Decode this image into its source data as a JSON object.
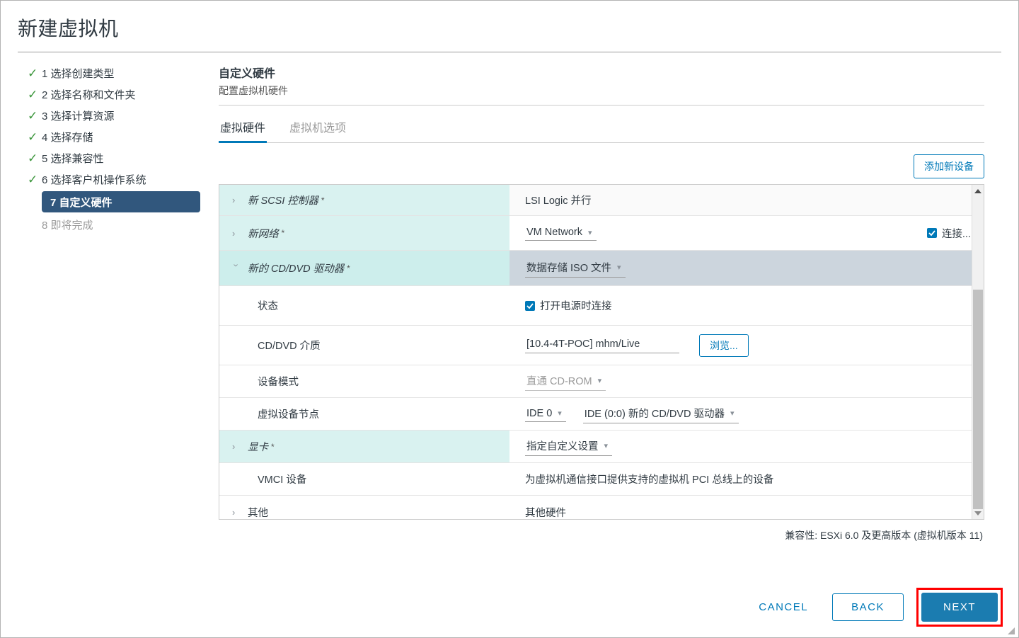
{
  "window": {
    "title": "新建虚拟机"
  },
  "steps": [
    {
      "num": "1",
      "label": "选择创建类型",
      "state": "done"
    },
    {
      "num": "2",
      "label": "选择名称和文件夹",
      "state": "done"
    },
    {
      "num": "3",
      "label": "选择计算资源",
      "state": "done"
    },
    {
      "num": "4",
      "label": "选择存储",
      "state": "done"
    },
    {
      "num": "5",
      "label": "选择兼容性",
      "state": "done"
    },
    {
      "num": "6",
      "label": "选择客户机操作系统",
      "state": "done"
    },
    {
      "num": "7",
      "label": "自定义硬件",
      "state": "active"
    },
    {
      "num": "8",
      "label": "即将完成",
      "state": "pending"
    }
  ],
  "step_labels": {
    "s1": "1 选择创建类型",
    "s2": "2 选择名称和文件夹",
    "s3": "3 选择计算资源",
    "s4": "4 选择存储",
    "s5": "5 选择兼容性",
    "s6": "6 选择客户机操作系统",
    "s7": "7 自定义硬件",
    "s8": "8 即将完成"
  },
  "section": {
    "title": "自定义硬件",
    "subtitle": "配置虚拟机硬件"
  },
  "tabs": {
    "hardware": "虚拟硬件",
    "vm_options": "虚拟机选项"
  },
  "toolbar": {
    "add_device_label": "添加新设备"
  },
  "hardware_rows": {
    "scsi": {
      "label": "新 SCSI 控制器",
      "star": "*",
      "value": "LSI Logic 并行"
    },
    "network": {
      "label": "新网络",
      "star": "*",
      "value": "VM Network",
      "connect_label": "连接...",
      "connect_checked": true
    },
    "cddvd": {
      "label": "新的 CD/DVD 驱动器",
      "star": "*",
      "value": "数据存储 ISO 文件"
    },
    "status": {
      "label": "状态",
      "checkbox_label": "打开电源时连接",
      "checked": true
    },
    "media": {
      "label": "CD/DVD 介质",
      "value": "[10.4-4T-POC] mhm/Live",
      "browse_label": "浏览..."
    },
    "device_mode": {
      "label": "设备模式",
      "value": "直通 CD-ROM",
      "disabled": true
    },
    "node": {
      "label": "虚拟设备节点",
      "bus_value": "IDE 0",
      "node_value": "IDE (0:0) 新的 CD/DVD 驱动器"
    },
    "video_card": {
      "label": "显卡",
      "star": "*",
      "value": "指定自定义设置"
    },
    "vmci": {
      "label": "VMCI 设备",
      "value": "为虚拟机通信接口提供支持的虚拟机 PCI 总线上的设备"
    },
    "other": {
      "label": "其他",
      "value": "其他硬件"
    }
  },
  "compatibility": {
    "text": "兼容性: ESXi 6.0 及更高版本 (虚拟机版本 11)"
  },
  "footer": {
    "cancel": "CANCEL",
    "back": "BACK",
    "next": "NEXT"
  },
  "colors": {
    "accent": "#0079b8",
    "next_button": "#1b7cb0",
    "active_step": "#31577d",
    "check_green": "#3c963c",
    "device_row": "#d9f2f0",
    "selected_value": "#ccd5dd",
    "annotation_red": "#ff0000"
  }
}
